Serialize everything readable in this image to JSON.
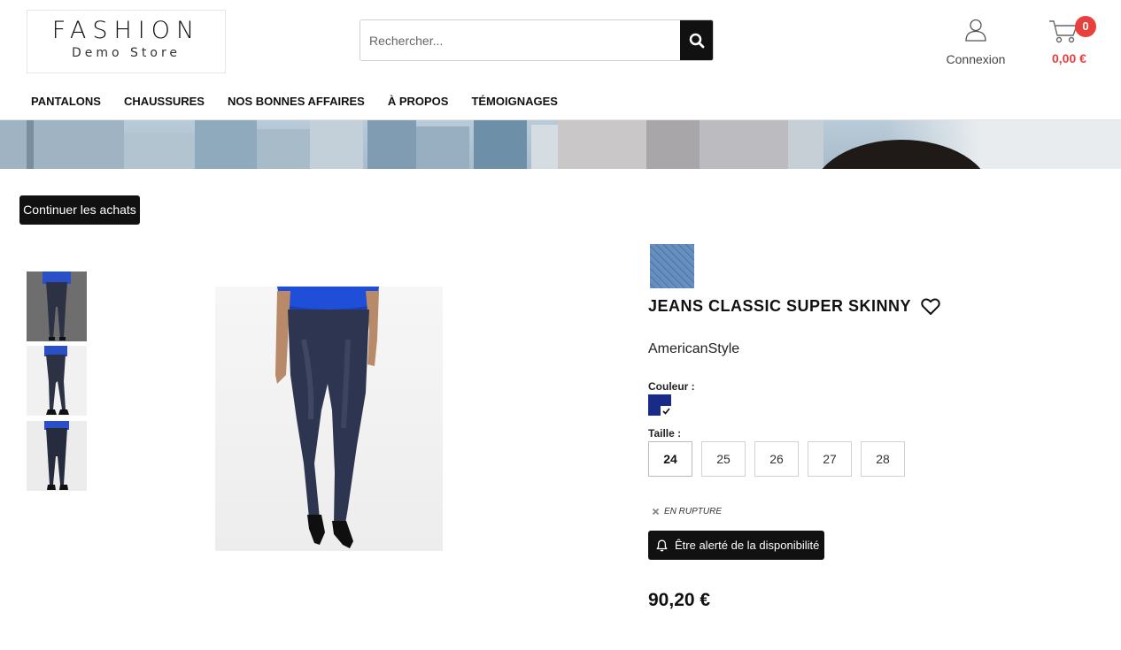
{
  "header": {
    "logo": {
      "title": "FASHION",
      "subtitle": "Demo Store"
    },
    "search": {
      "placeholder": "Rechercher...",
      "value": ""
    },
    "account": {
      "label": "Connexion"
    },
    "cart": {
      "count": "0",
      "total": "0,00 €"
    },
    "nav": [
      {
        "label": "PANTALONS"
      },
      {
        "label": "CHAUSSURES"
      },
      {
        "label": "NOS BONNES AFFAIRES"
      },
      {
        "label": "À PROPOS"
      },
      {
        "label": "TÉMOIGNAGES"
      }
    ]
  },
  "page": {
    "continue_label": "Continuer les achats"
  },
  "product": {
    "title": "JEANS CLASSIC SUPER SKINNY",
    "brand": "AmericanStyle",
    "color_label": "Couleur :",
    "selected_color": "#1a2a87",
    "size_label": "Taille :",
    "sizes": [
      {
        "label": "24",
        "selected": true
      },
      {
        "label": "25",
        "selected": false
      },
      {
        "label": "26",
        "selected": false
      },
      {
        "label": "27",
        "selected": false
      },
      {
        "label": "28",
        "selected": false
      }
    ],
    "stock_status": "EN RUPTURE",
    "alert_label": "Être alerté de la disponibilité",
    "price": "90,20 €",
    "thumbnails": 3
  },
  "colors": {
    "accent": "#e8403d",
    "dark": "#111111"
  }
}
